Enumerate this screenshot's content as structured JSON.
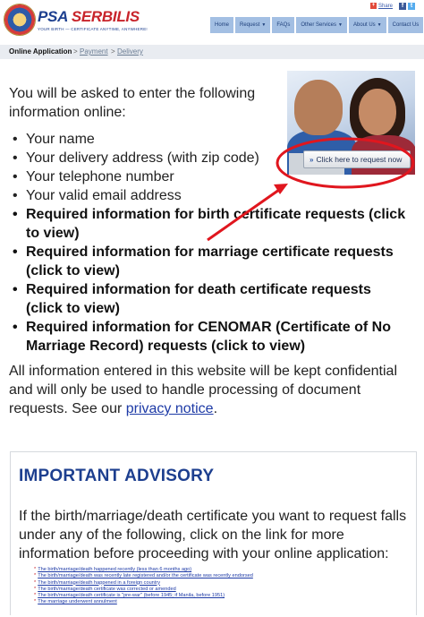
{
  "header": {
    "logo_main": "PSA ",
    "logo_accent": "SERBILIS",
    "logo_tagline": "YOUR BIRTH — CERTIFICATE ANYTIME, ANYWHERE!",
    "share_label": "Share",
    "nav": [
      {
        "label": "Home",
        "caret": false
      },
      {
        "label": "Request",
        "caret": true
      },
      {
        "label": "FAQs",
        "caret": false
      },
      {
        "label": "Other Services",
        "caret": true
      },
      {
        "label": "About Us",
        "caret": true
      },
      {
        "label": "Contact Us",
        "caret": false
      }
    ]
  },
  "breadcrumb": {
    "current": "Online Application",
    "separator": ">",
    "step2": "Payment",
    "step3": "Delivery"
  },
  "promo": {
    "button_label": "Click here to request now",
    "annotation_color": "#e0161e"
  },
  "main": {
    "intro": "You will be asked to enter the following information online:",
    "items": [
      {
        "text": "Your name",
        "required": false
      },
      {
        "text": "Your delivery address (with zip code)",
        "required": false
      },
      {
        "text": "Your telephone number",
        "required": false
      },
      {
        "text": "Your valid email address",
        "required": false
      },
      {
        "text": "Required information for birth certificate requests (click to view)",
        "required": true
      },
      {
        "text": "Required information for marriage certificate requests (click to view)",
        "required": true
      },
      {
        "text": "Required information for death certificate requests (click to view)",
        "required": true
      },
      {
        "text": "Required information for CENOMAR (Certificate of No Marriage Record) requests (click to view)",
        "required": true
      }
    ],
    "confidential_text": "All information entered in this website will be kept confidential and will only be used to handle processing of document requests. See our ",
    "privacy_link": "privacy notice",
    "confidential_end": "."
  },
  "advisory": {
    "title": "IMPORTANT ADVISORY",
    "body": "If the birth/marriage/death certificate you want to request falls under any of the following, click on the link for more information before proceeding with your online application:",
    "links": [
      "The birth/marriage/death happened recently (less than 6 months ago)",
      "The birth/marriage/death was recently late registered and/or the certificate was recently endorsed",
      "The birth/marriage/death happened in a foreign country",
      "The birth/marriage/death certificate was corrected or amended",
      "The birth/marriage/death certificate is \"pre-war\" (before 1945; if Manila, before 1951)",
      "The marriage underwent annulment"
    ]
  },
  "colors": {
    "brand_blue": "#1d3f8f",
    "brand_red": "#c8242b",
    "nav_bg": "#a3bfe3",
    "link": "#1d3aa6"
  }
}
